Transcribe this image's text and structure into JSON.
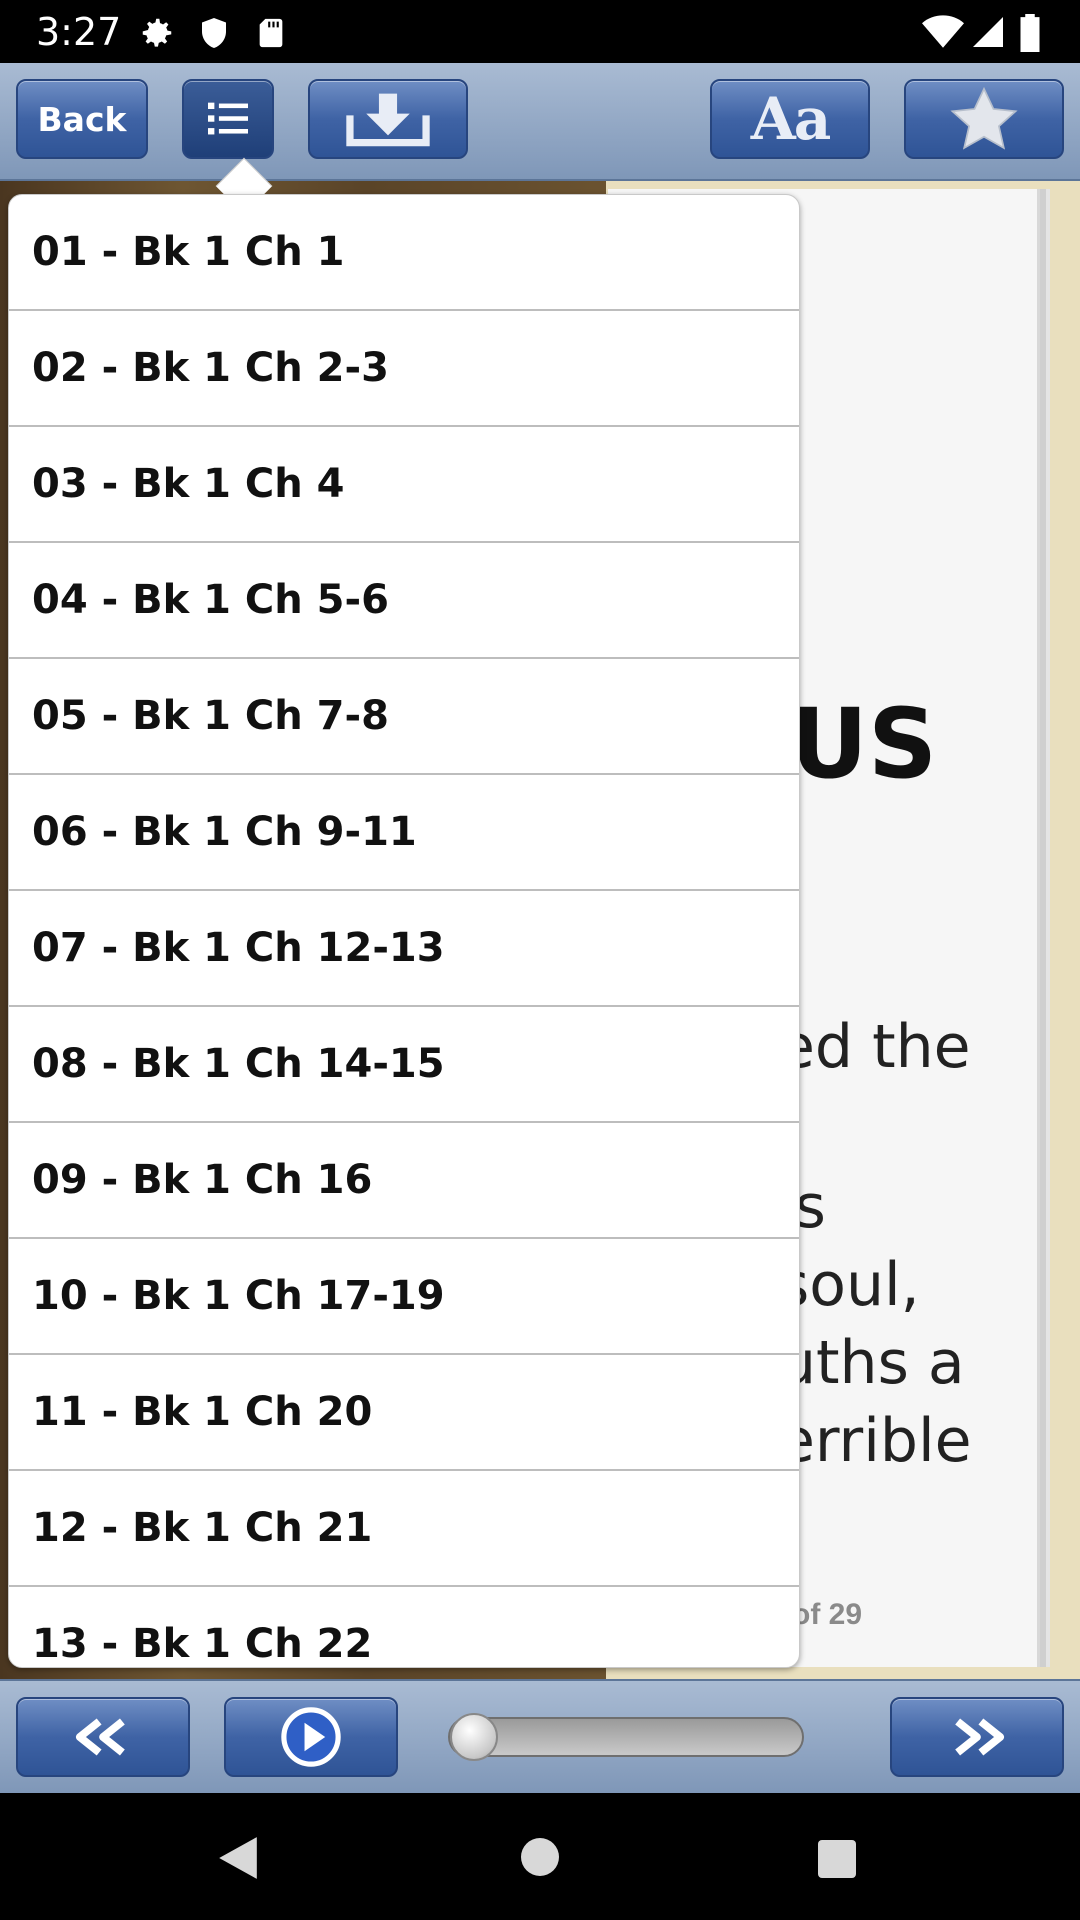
{
  "status_bar": {
    "time": "3:27",
    "left_icons": [
      "gear-icon",
      "shield-icon",
      "sd-card-icon"
    ],
    "right_icons": [
      "wifi-icon",
      "signal-icon",
      "battery-icon"
    ]
  },
  "toolbar": {
    "back_label": "Back",
    "font_label": "Aa",
    "icons": [
      "list-icon",
      "download-icon",
      "star-icon"
    ],
    "colors": {
      "button": "#3f63a5",
      "bar": "#a9bbd3"
    }
  },
  "book_page": {
    "title_fragment": "US",
    "lines": [
      "ed the",
      "is",
      "soul,",
      "uths a",
      "errible"
    ],
    "page_count": "of 29"
  },
  "chapter_list": {
    "items": [
      "01 - Bk 1 Ch 1",
      "02 - Bk 1 Ch 2-3",
      "03 - Bk 1 Ch 4",
      "04 - Bk 1 Ch 5-6",
      "05 - Bk 1 Ch 7-8",
      "06 - Bk 1 Ch 9-11",
      "07 - Bk 1 Ch 12-13",
      "08 - Bk 1 Ch 14-15",
      "09 - Bk 1 Ch 16",
      "10 - Bk 1 Ch 17-19",
      "11 - Bk 1 Ch 20",
      "12 - Bk 1 Ch 21",
      "13 - Bk 1 Ch 22"
    ]
  },
  "player": {
    "icons": [
      "rewind-icon",
      "play-icon",
      "fast-forward-icon"
    ],
    "progress": 0
  },
  "nav_bar": {
    "icons": [
      "back-triangle-icon",
      "home-circle-icon",
      "recents-square-icon"
    ]
  }
}
